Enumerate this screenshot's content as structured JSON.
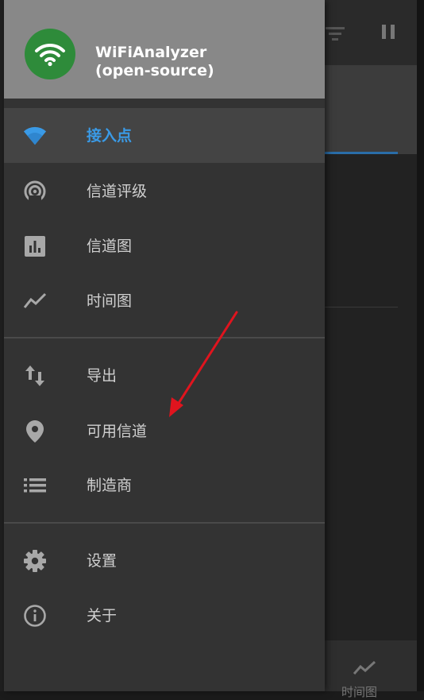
{
  "app": {
    "title_line1": "WiFiAnalyzer",
    "title_line2": "(open-source)",
    "logo_icon": "wifi-icon",
    "logo_color": "#2e8b3a"
  },
  "drawer": {
    "groups": [
      {
        "items": [
          {
            "label": "接入点",
            "icon": "wifi-icon",
            "selected": true
          },
          {
            "label": "信道评级",
            "icon": "signal-rating-icon",
            "selected": false
          },
          {
            "label": "信道图",
            "icon": "bar-chart-icon",
            "selected": false
          },
          {
            "label": "时间图",
            "icon": "line-chart-icon",
            "selected": false
          }
        ]
      },
      {
        "items": [
          {
            "label": "导出",
            "icon": "export-arrows-icon",
            "selected": false
          },
          {
            "label": "可用信道",
            "icon": "location-pin-icon",
            "selected": false
          },
          {
            "label": "制造商",
            "icon": "list-icon",
            "selected": false
          }
        ]
      },
      {
        "items": [
          {
            "label": "设置",
            "icon": "gear-icon",
            "selected": false
          },
          {
            "label": "关于",
            "icon": "info-icon",
            "selected": false
          }
        ]
      }
    ]
  },
  "background": {
    "bottom_tab_label": "时间图",
    "bottom_tab_icon": "line-chart-icon",
    "toolbar_icons": [
      "filter-icon",
      "pause-icon"
    ]
  },
  "colors": {
    "accent": "#3a9ae6",
    "drawer_bg": "#333333",
    "header_bg": "#888888",
    "annotation_arrow": "#e0141e"
  },
  "annotation": {
    "type": "arrow",
    "points_to": "可用信道"
  }
}
